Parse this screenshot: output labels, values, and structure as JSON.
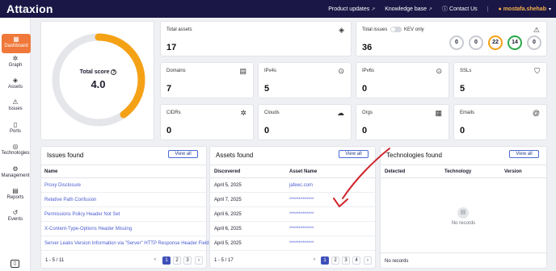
{
  "topbar": {
    "logo_mark": "A",
    "logo_text": "ttaxion",
    "nav": [
      {
        "label": "Product updates",
        "icon": "external-link-icon"
      },
      {
        "label": "Knowledge base",
        "icon": "external-link-icon"
      },
      {
        "label": "Contact Us",
        "icon": "question-icon"
      }
    ],
    "user": "mostafa.shehab",
    "colors": {
      "bg": "#1a1746",
      "user": "#f5b04a"
    }
  },
  "sidebar": {
    "items": [
      {
        "label": "Dashboard",
        "icon": "dashboard-icon",
        "active": true
      },
      {
        "label": "Graph",
        "icon": "graph-icon"
      },
      {
        "label": "Assets",
        "icon": "assets-icon"
      },
      {
        "label": "Issues",
        "icon": "warning-icon"
      },
      {
        "label": "Ports",
        "icon": "ports-icon"
      },
      {
        "label": "Technologies",
        "icon": "technologies-icon"
      },
      {
        "label": "Management",
        "icon": "gear-icon"
      },
      {
        "label": "Reports",
        "icon": "reports-icon"
      },
      {
        "label": "Events",
        "icon": "history-icon"
      }
    ],
    "accent": "#f0783a"
  },
  "score": {
    "label": "Total score",
    "value": "4.0",
    "fraction": 0.4,
    "color": "#f5a115"
  },
  "stats": {
    "total_assets": {
      "label": "Total assets",
      "value": "17"
    },
    "total_issues": {
      "label": "Total issues",
      "value": "36",
      "kev_label": "KEV only"
    },
    "severity": [
      {
        "value": "0",
        "color": "#c8cbd1"
      },
      {
        "value": "0",
        "color": "#c8cbd1"
      },
      {
        "value": "22",
        "color": "#f5a115"
      },
      {
        "value": "14",
        "color": "#2aa84a"
      },
      {
        "value": "0",
        "color": "#c8cbd1"
      }
    ],
    "domains": {
      "label": "Domains",
      "value": "7"
    },
    "ipv4s": {
      "label": "IPv4s",
      "value": "5"
    },
    "ipv6s": {
      "label": "IPv6s",
      "value": "0"
    },
    "ssls": {
      "label": "SSLs",
      "value": "5"
    },
    "cidrs": {
      "label": "CIDRs",
      "value": "0"
    },
    "clouds": {
      "label": "Clouds",
      "value": "0"
    },
    "orgs": {
      "label": "Orgs",
      "value": "0"
    },
    "emails": {
      "label": "Emails",
      "value": "0"
    }
  },
  "issues_panel": {
    "title": "Issues found",
    "view_all": "View all",
    "col_name": "Name",
    "rows": [
      "Proxy Disclosure",
      "Relative Path Confusion",
      "Permissions Policy Header Not Set",
      "X-Content-Type-Options Header Missing",
      "Server Leaks Version Information via \"Server\" HTTP Response Header Field"
    ],
    "pager_info": "1 - 5 / 11",
    "pages": [
      "1",
      "2",
      "3"
    ]
  },
  "assets_panel": {
    "title": "Assets found",
    "view_all": "View all",
    "col_discovered": "Discovered",
    "col_name": "Asset Name",
    "rows": [
      {
        "date": "April 5, 2025",
        "name": "jafeec.com"
      },
      {
        "date": "April 7, 2025",
        "name": "*************"
      },
      {
        "date": "April 6, 2025",
        "name": "*************"
      },
      {
        "date": "April 6, 2025",
        "name": "*************"
      },
      {
        "date": "April 5, 2025",
        "name": "*************"
      }
    ],
    "pager_info": "1 - 5 / 17",
    "pages": [
      "1",
      "2",
      "3",
      "4"
    ]
  },
  "tech_panel": {
    "title": "Technologies found",
    "view_all": "View all",
    "col_detected": "Detected",
    "col_technology": "Technology",
    "col_version": "Version",
    "empty_text": "No records",
    "footer": "No records"
  },
  "annotation": {
    "color": "#d0242b"
  }
}
